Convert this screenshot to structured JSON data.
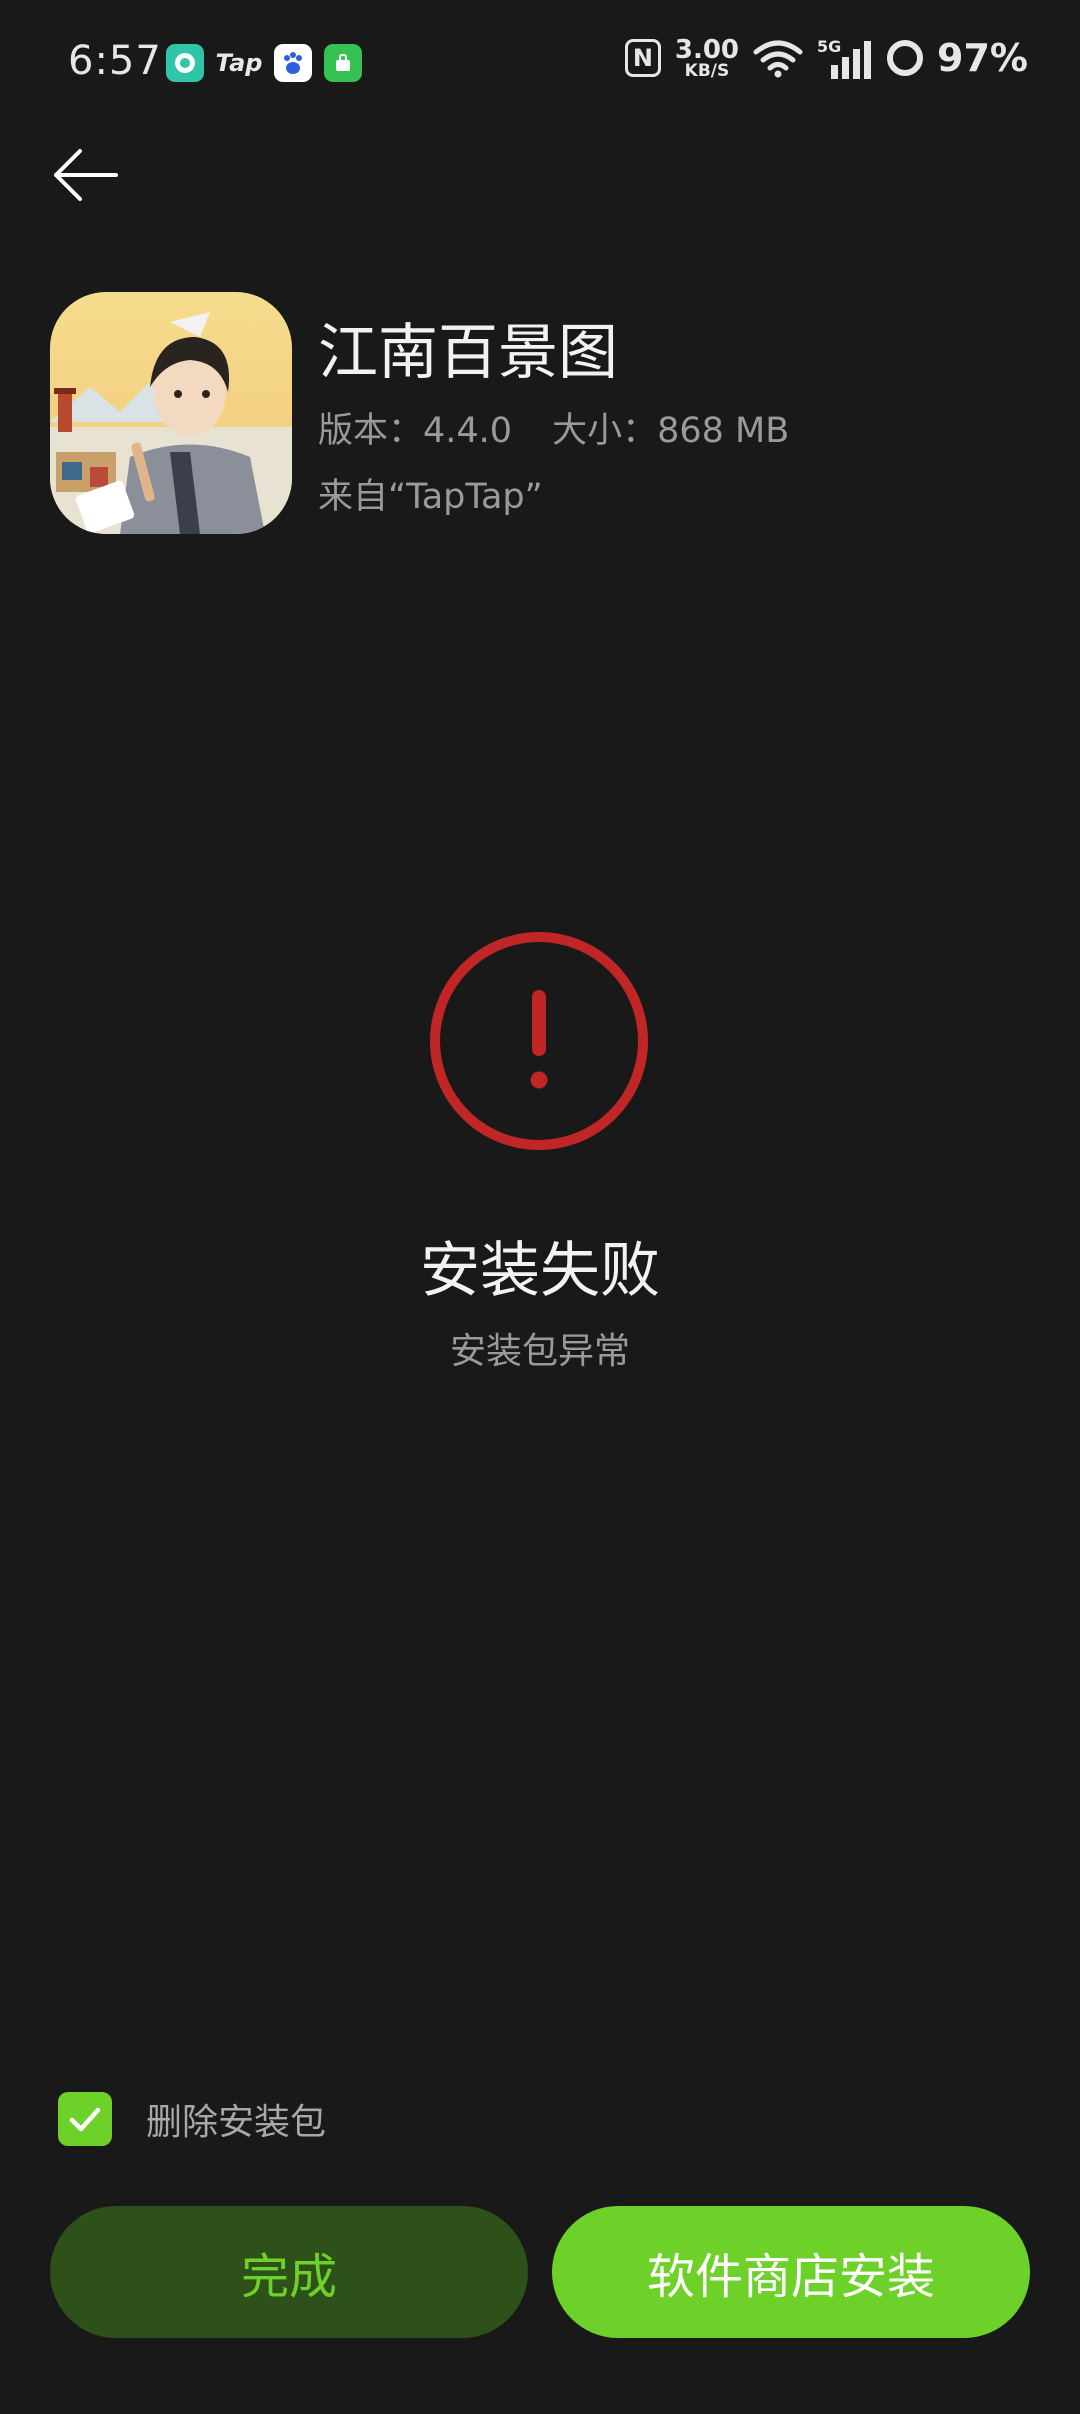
{
  "status_bar": {
    "time": "6:57",
    "notification_icons": [
      "chat-app-icon",
      "taptap-icon",
      "baidu-icon",
      "green-app-icon"
    ],
    "tap_label": "Tap",
    "nfc_label": "N",
    "net_speed": "3.00",
    "net_speed_unit": "KB/S",
    "network_type": "5G",
    "battery": "97%"
  },
  "app": {
    "name": "江南百景图",
    "version": "版本：4.4.0",
    "size": "大小：868 MB",
    "source": "来自“TapTap”"
  },
  "result": {
    "title": "安装失败",
    "subtitle": "安装包异常",
    "icon": "error-exclamation-icon",
    "icon_color": "#c12626"
  },
  "options": {
    "delete_package_label": "删除安装包",
    "delete_package_checked": true
  },
  "buttons": {
    "done_label": "完成",
    "store_install_label": "软件商店安装"
  },
  "colors": {
    "background": "#191919",
    "accent": "#6dd12a",
    "accent_dark": "#2d5119"
  }
}
